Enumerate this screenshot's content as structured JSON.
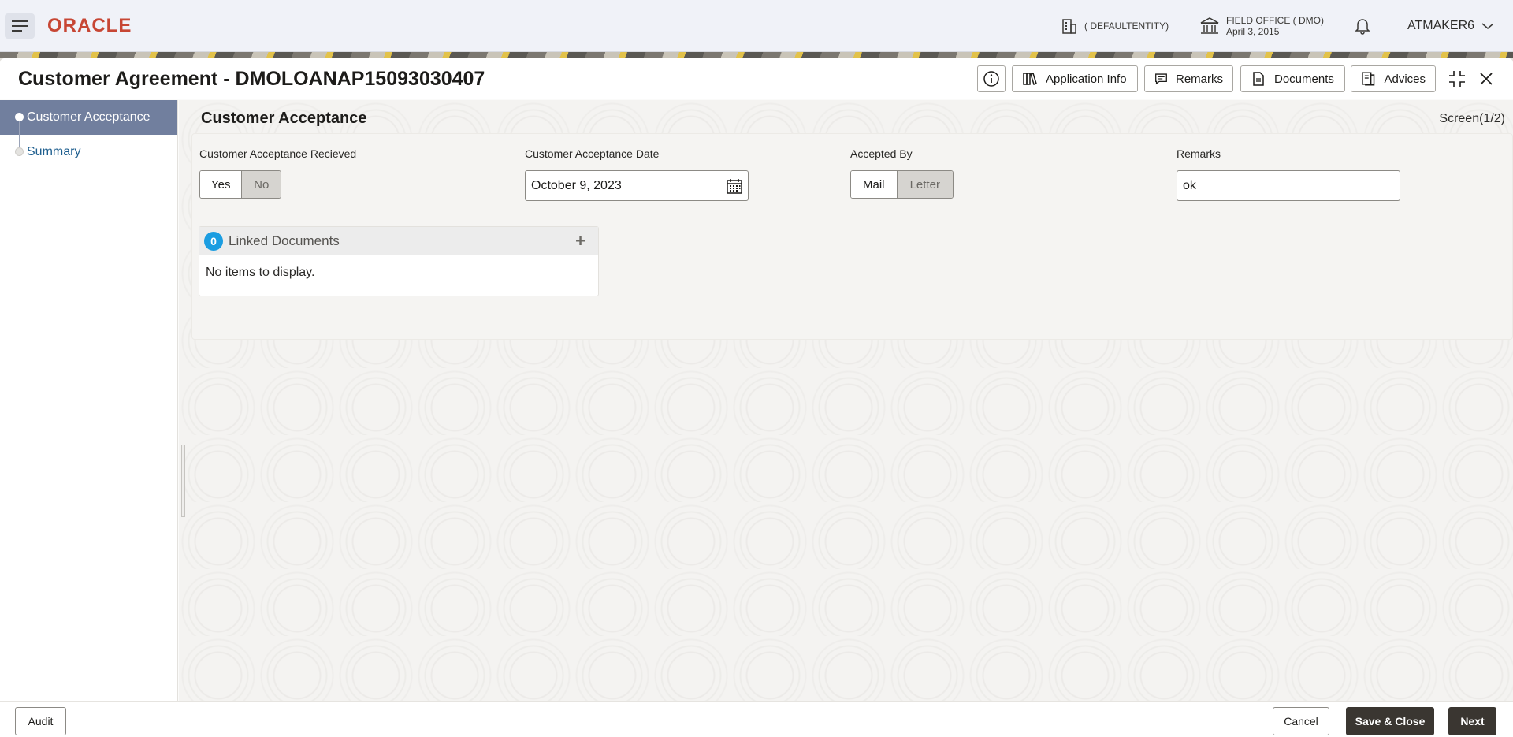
{
  "header": {
    "logo": "ORACLE",
    "entity": "( DEFAULTENTITY)",
    "office_name": "FIELD OFFICE ( DMO)",
    "office_date": "April 3, 2015",
    "user": "ATMAKER6"
  },
  "window": {
    "title": "Customer Agreement - DMOLOANAP15093030407",
    "toolbar": {
      "application_info": "Application Info",
      "remarks": "Remarks",
      "documents": "Documents",
      "advices": "Advices"
    }
  },
  "sidebar": {
    "items": [
      {
        "label": "Customer Acceptance",
        "active": true
      },
      {
        "label": "Summary",
        "active": false
      }
    ]
  },
  "content": {
    "section_title": "Customer Acceptance",
    "screen_count": "Screen(1/2)",
    "fields": {
      "acceptance_received": {
        "label": "Customer Acceptance Recieved",
        "options": [
          "Yes",
          "No"
        ],
        "selected": "Yes"
      },
      "acceptance_date": {
        "label": "Customer Acceptance Date",
        "value": "October 9, 2023"
      },
      "accepted_by": {
        "label": "Accepted By",
        "options": [
          "Mail",
          "Letter"
        ],
        "selected": "Mail"
      },
      "remarks": {
        "label": "Remarks",
        "value": "ok"
      }
    },
    "linked_documents": {
      "count": "0",
      "title": "Linked Documents",
      "empty_text": "No items to display."
    }
  },
  "footer": {
    "audit": "Audit",
    "cancel": "Cancel",
    "save_close": "Save & Close",
    "next": "Next"
  },
  "colors": {
    "brand": "#c74634",
    "sidebar_active": "#717f9e",
    "badge": "#1b9de1",
    "primary_button": "#3a3631"
  }
}
